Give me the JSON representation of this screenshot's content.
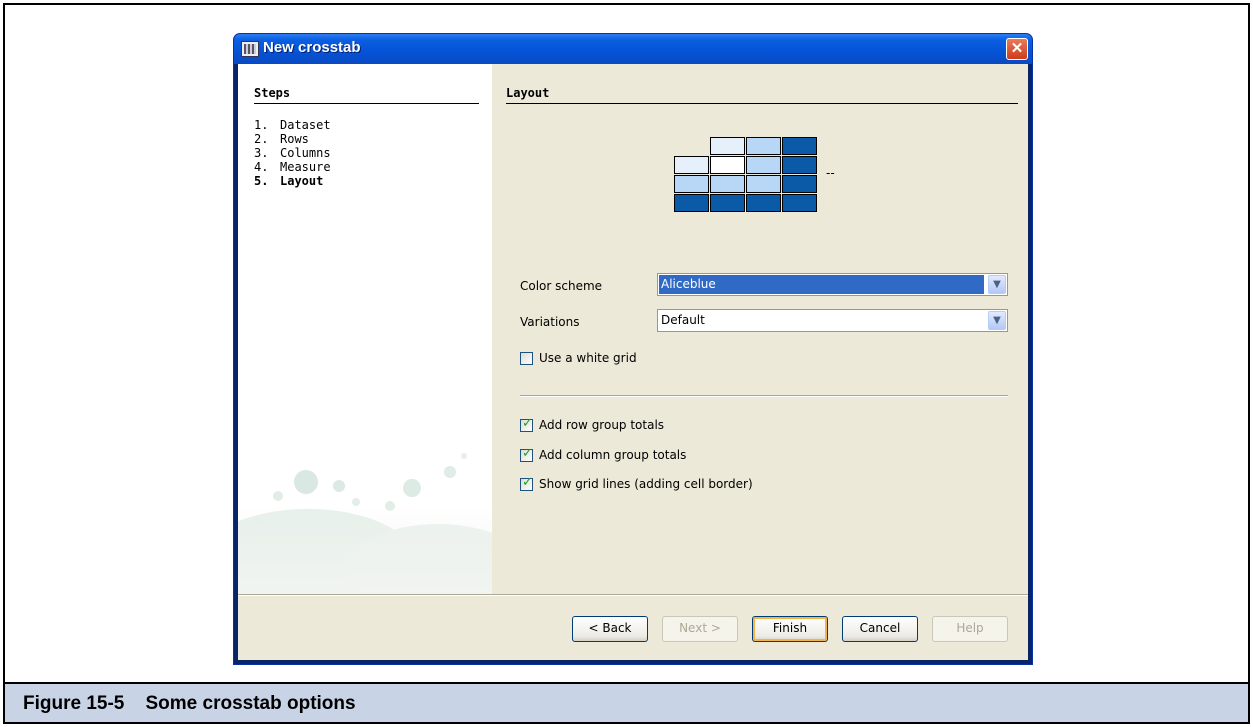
{
  "window": {
    "title": "New crosstab",
    "close_glyph": "✕"
  },
  "steps": {
    "header": "Steps",
    "items": [
      {
        "num": "1.",
        "label": "Dataset",
        "active": false
      },
      {
        "num": "2.",
        "label": "Rows",
        "active": false
      },
      {
        "num": "3.",
        "label": "Columns",
        "active": false
      },
      {
        "num": "4.",
        "label": "Measure",
        "active": false
      },
      {
        "num": "5.",
        "label": "Layout",
        "active": true
      }
    ]
  },
  "layout": {
    "header": "Layout",
    "preview_suffix": "--",
    "color_scheme_label": "Color scheme",
    "color_scheme_value": "Aliceblue",
    "variations_label": "Variations",
    "variations_value": "Default",
    "white_grid_label": "Use a white grid",
    "white_grid_checked": false,
    "row_totals_label": "Add row group totals",
    "row_totals_checked": true,
    "column_totals_label": "Add column group totals",
    "column_totals_checked": true,
    "grid_lines_label": "Show grid lines (adding cell border)",
    "grid_lines_checked": true
  },
  "buttons": {
    "back": "< Back",
    "next": "Next >",
    "finish": "Finish",
    "cancel": "Cancel",
    "help": "Help"
  },
  "colors": {
    "titlebar": "#0553d6",
    "scheme_light": "#e6f0fb",
    "scheme_mid": "#b8d6f5",
    "scheme_dark": "#0b5aa7"
  },
  "caption": "Figure 15-5    Some crosstab options"
}
